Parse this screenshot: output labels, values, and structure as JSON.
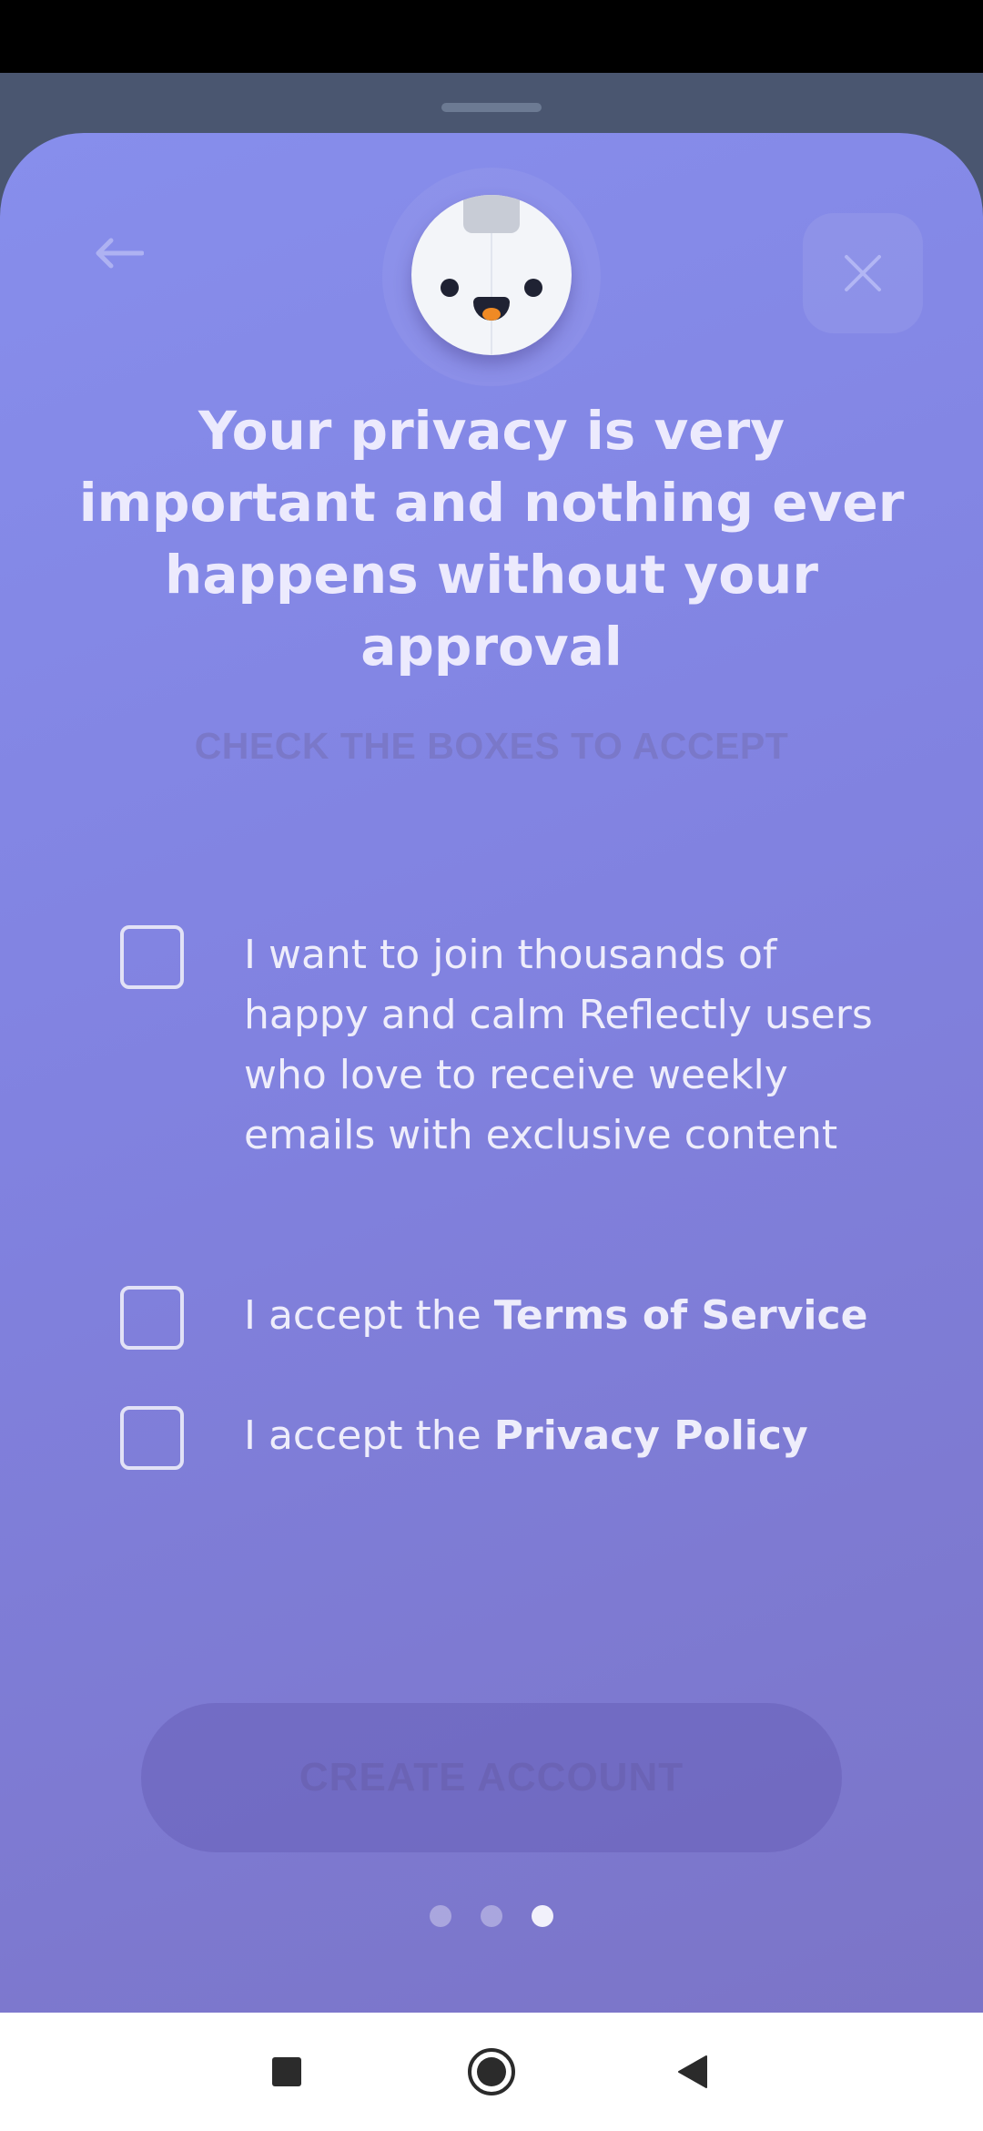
{
  "header": {
    "back_icon": "arrow-left-icon",
    "close_icon": "close-icon",
    "mascot": "reflectly-robot-avatar"
  },
  "title": "Your privacy is very important and nothing ever happens without your approval",
  "subtitle": "CHECK THE BOXES TO ACCEPT",
  "consents": [
    {
      "checked": false,
      "text": "I want to join thousands of happy and calm Reflectly users who love to receive weekly emails with exclusive content",
      "bold": ""
    },
    {
      "checked": false,
      "text": "I accept the ",
      "bold": "Terms of Service"
    },
    {
      "checked": false,
      "text": "I accept the ",
      "bold": "Privacy Policy"
    }
  ],
  "cta_label": "CREATE ACCOUNT",
  "pagination": {
    "total": 3,
    "current": 3
  },
  "system_nav": [
    "recents-square-icon",
    "home-circle-icon",
    "back-triangle-icon"
  ],
  "colors": {
    "sheet_top": "#878eec",
    "sheet_bottom": "#7b74c7",
    "backdrop": "#4a5670",
    "mascot_tongue": "#f08a24"
  }
}
